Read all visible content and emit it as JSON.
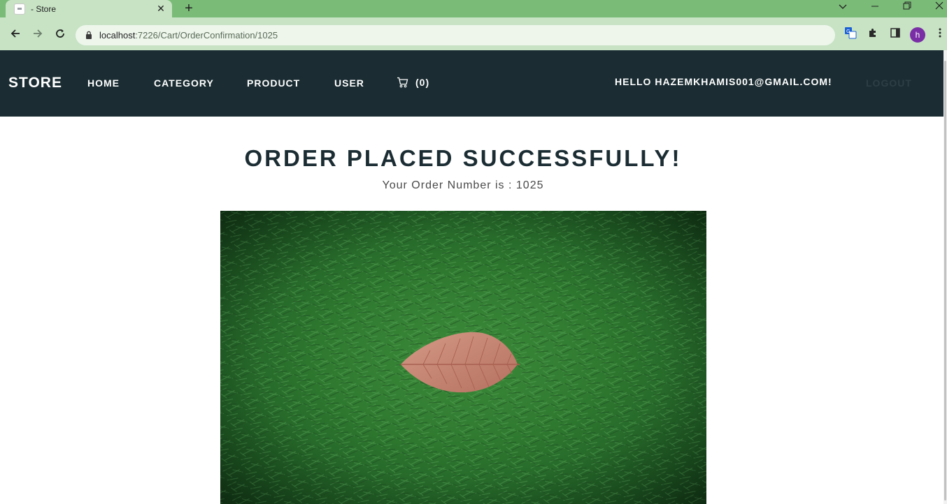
{
  "browser": {
    "tab_title": "- Store",
    "url_host": "localhost",
    "url_path": ":7226/Cart/OrderConfirmation/1025",
    "profile_initial": "h"
  },
  "navbar": {
    "brand": "STORE",
    "links": [
      "HOME",
      "CATEGORY",
      "PRODUCT",
      "USER"
    ],
    "cart_count": "(0)",
    "greeting": "HELLO HAZEMKHAMIS001@GMAIL.COM!",
    "logout": "LOGOUT"
  },
  "confirmation": {
    "heading": "ORDER PLACED SUCCESSFULLY!",
    "order_label": "Your Order Number is :",
    "order_number": "1025"
  },
  "colors": {
    "tab_bar": "#7bbb78",
    "toolbar": "#c7e3c4",
    "navbar": "#1b2d33",
    "heading": "#1b2d33"
  }
}
